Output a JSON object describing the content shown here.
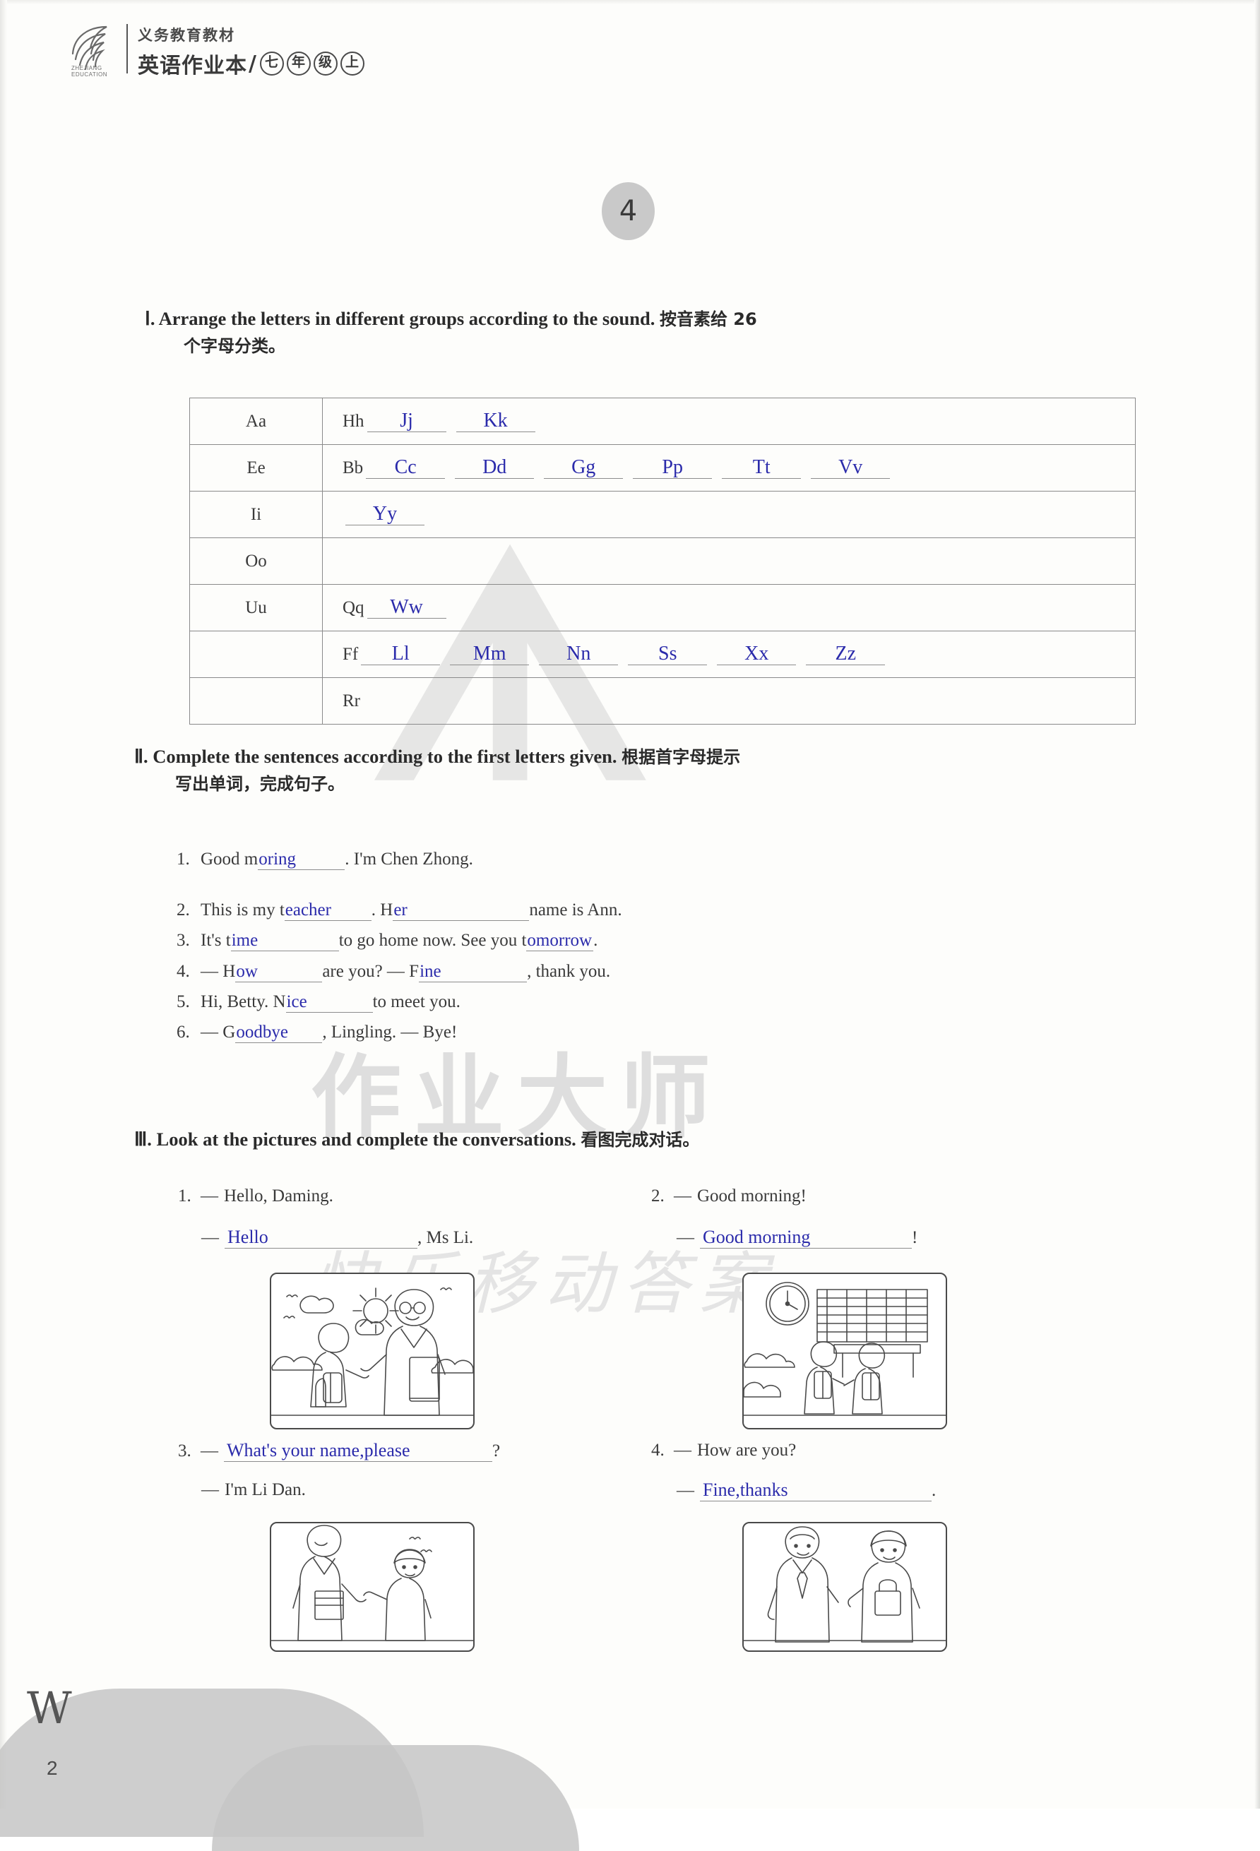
{
  "header": {
    "logo_caption": "ZHEJIANG EDUCATION",
    "series_title": "义务教育教材",
    "book_title": "英语作业本",
    "slash": "/",
    "grade_chars": [
      "七",
      "年",
      "级",
      "上"
    ]
  },
  "unit_badge": "4",
  "watermarks": {
    "brand_cn": "作业大师",
    "handwriting": "快乐移动答案"
  },
  "exercises": [
    {
      "label": "Ⅰ.",
      "en": "Arrange the letters in different groups according to the sound.",
      "cn_line1": "按音素给 26",
      "cn_line2": "个字母分类。"
    },
    {
      "label": "Ⅱ.",
      "en": "Complete the sentences according to the first letters given.",
      "cn_line1": "根据首字母提示",
      "cn_line2": "写出单词，完成句子。"
    },
    {
      "label": "Ⅲ.",
      "en": "Look at the pictures and complete the conversations.",
      "cn_line1": "看图完成对话。"
    }
  ],
  "letter_table": {
    "rows": [
      {
        "vowel": "Aa",
        "seed": "Hh",
        "answers": [
          "Jj",
          "Kk"
        ]
      },
      {
        "vowel": "Ee",
        "seed": "Bb",
        "answers": [
          "Cc",
          "Dd",
          "Gg",
          "Pp",
          "Tt",
          "Vv"
        ]
      },
      {
        "vowel": "Ii",
        "seed": "",
        "answers": [
          "Yy"
        ]
      },
      {
        "vowel": "Oo",
        "seed": "",
        "answers": []
      },
      {
        "vowel": "Uu",
        "seed": "Qq",
        "answers": [
          "Ww"
        ]
      },
      {
        "vowel": "",
        "seed": "Ff",
        "answers": [
          "Ll",
          "Mm",
          "Nn",
          "Ss",
          "Xx",
          "Zz"
        ]
      },
      {
        "vowel": "",
        "seed": "Rr",
        "answers": []
      }
    ]
  },
  "sentences": [
    {
      "num": "1.",
      "before": "Good m",
      "answer": "oring",
      "after": ". I'm Chen Zhong."
    },
    {
      "num": "2.",
      "before": "This is my t",
      "answer": "eacher",
      "mid": ". H",
      "answer2": "er",
      "after": "name is Ann."
    },
    {
      "num": "3.",
      "before": "It's t",
      "answer": "ime",
      "mid": "to go home now. See you t",
      "answer2": "omorrow",
      "after": "."
    },
    {
      "num": "4.",
      "before": "— H",
      "answer": "ow",
      "mid": "are you?     — F",
      "answer2": "ine",
      "after": ", thank you."
    },
    {
      "num": "5.",
      "before": "Hi, Betty. N",
      "answer": "ice",
      "after": "to meet you."
    },
    {
      "num": "6.",
      "before": "— G",
      "answer": "oodbye",
      "after": ", Lingling.      — Bye!"
    }
  ],
  "dialogues": [
    {
      "num": "1.",
      "prompt_dash": "—",
      "prompt": "Hello, Daming.",
      "reply_dash": "—",
      "reply_answer": "Hello",
      "reply_tail": ", Ms Li.",
      "picture": "student-greets-teacher-outdoors"
    },
    {
      "num": "2.",
      "prompt_dash": "—",
      "prompt": "Good morning!",
      "reply_dash": "—",
      "reply_answer": "Good morning",
      "reply_tail": "!",
      "picture": "students-in-classroom-with-clock"
    },
    {
      "num": "3.",
      "prompt_dash": "—",
      "prompt_answer": "What's your name,please",
      "prompt_tail": "?",
      "reply_dash": "—",
      "reply": "I'm Li Dan.",
      "picture": "teacher-asking-girl-name"
    },
    {
      "num": "4.",
      "prompt_dash": "—",
      "prompt": "How are you?",
      "reply_dash": "—",
      "reply_answer": "Fine,thanks",
      "reply_tail": ".",
      "picture": "two-students-talking"
    }
  ],
  "footer": {
    "decor_letter": "W",
    "page_number": "2"
  },
  "colors": {
    "handwriting_ink": "#2b2bab",
    "print_text": "#3a3a3a",
    "rule_line": "#8d8d8d",
    "watermark": "#e2e2e2"
  }
}
